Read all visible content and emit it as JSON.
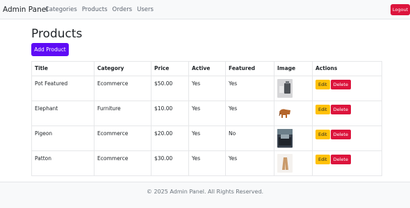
{
  "navbar": {
    "brand": "Admin Panel",
    "links": [
      "Categories",
      "Products",
      "Orders",
      "Users"
    ],
    "logout_label": "Logout"
  },
  "page": {
    "title": "Products",
    "add_button": "Add Product"
  },
  "table": {
    "headers": [
      "Title",
      "Category",
      "Price",
      "Active",
      "Featured",
      "Image",
      "Actions"
    ],
    "rows": [
      {
        "title": "Pot Featured",
        "category": "Ecommerce",
        "price": "$50.00",
        "active": "Yes",
        "featured": "Yes",
        "image_icon": "pot-thumbnail"
      },
      {
        "title": "Elephant",
        "category": "Furniture",
        "price": "$10.00",
        "active": "Yes",
        "featured": "Yes",
        "image_icon": "elephant-thumbnail"
      },
      {
        "title": "Pigeon",
        "category": "Ecommerce",
        "price": "$20.00",
        "active": "Yes",
        "featured": "No",
        "image_icon": "pigeon-thumbnail"
      },
      {
        "title": "Patton",
        "category": "Ecommerce",
        "price": "$30.00",
        "active": "Yes",
        "featured": "Yes",
        "image_icon": "patton-thumbnail"
      }
    ],
    "edit_label": "Edit",
    "delete_label": "Delete"
  },
  "footer": {
    "text": "© 2025 Admin Panel. All Rights Reserved."
  },
  "colors": {
    "primary": "#5f0cf5",
    "danger": "#dc143c",
    "warning": "#ffc107",
    "navbar_bg": "#f8f9fa"
  }
}
